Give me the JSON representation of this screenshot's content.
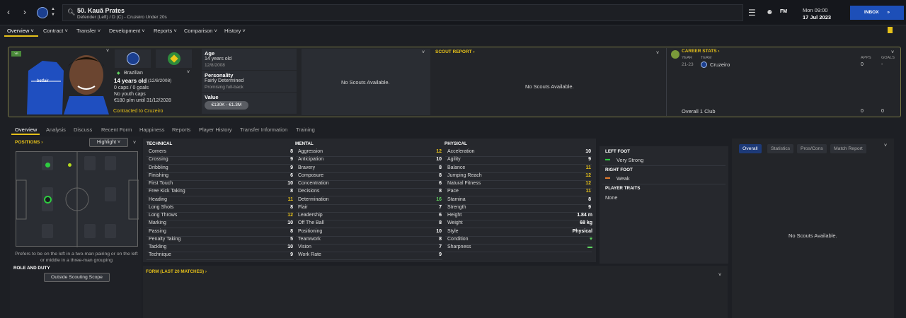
{
  "topbar": {
    "back": "‹",
    "forward": "›",
    "player_title": "50. Kauã Prates",
    "player_subtitle": "Defender (Left) / D (C) - Cruzeiro Under 20s",
    "fm_label": "FM",
    "date_line1": "Mon 09:00",
    "date_line2": "17 Jul 2023",
    "inbox_label": "INBOX"
  },
  "menu": [
    "Overview",
    "Contract",
    "Transfer",
    "Development",
    "Reports",
    "Comparison",
    "History"
  ],
  "profile": {
    "youth_badge": "YR",
    "nationality": "Brazilian",
    "age_line": "14 years old",
    "dob_paren": "(12/8/2008)",
    "caps": "0 caps / 0 goals",
    "youth_caps": "No youth caps",
    "wage": "€180 p/m until 31/12/2028",
    "contract": "Contracted to Cruzeiro",
    "age_title": "Age",
    "age_value": "14 years old",
    "age_dob": "12/8/2008",
    "personality_title": "Personality",
    "personality_value": "Fairly Determined",
    "personality_sub": "Promising full-back",
    "value_title": "Value",
    "value_range": "€130K - €1.3M",
    "no_scouts_1": "No Scouts Available.",
    "scout_report_title": "SCOUT REPORT",
    "no_scouts_2": "No Scouts Available."
  },
  "career": {
    "title": "CAREER STATS",
    "col_year": "YEAR",
    "col_team": "TEAM",
    "col_apps": "APPS",
    "col_goals": "GOALS",
    "row_year": "21-23",
    "row_team": "Cruzeiro",
    "row_apps": "0",
    "row_goals": "-",
    "total_label": "Overall 1 Club",
    "total_apps": "0",
    "total_goals": "0"
  },
  "subtabs": [
    "Overview",
    "Analysis",
    "Discuss",
    "Recent Form",
    "Happiness",
    "Reports",
    "Player History",
    "Transfer Information",
    "Training"
  ],
  "positions": {
    "title": "POSITIONS",
    "highlight": "Highlight",
    "note": "Prefers to be on the left in a two-man pairing or on the left or middle in a three-man grouping",
    "role_title": "ROLE AND DUTY",
    "scope_button": "Outside Scouting Scope"
  },
  "attributes": {
    "technical_title": "TECHNICAL",
    "mental_title": "MENTAL",
    "physical_title": "PHYSICAL",
    "technical": [
      {
        "name": "Corners",
        "value": "8"
      },
      {
        "name": "Crossing",
        "value": "9"
      },
      {
        "name": "Dribbling",
        "value": "9"
      },
      {
        "name": "Finishing",
        "value": "6"
      },
      {
        "name": "First Touch",
        "value": "10"
      },
      {
        "name": "Free Kick Taking",
        "value": "8"
      },
      {
        "name": "Heading",
        "value": "11"
      },
      {
        "name": "Long Shots",
        "value": "8"
      },
      {
        "name": "Long Throws",
        "value": "12"
      },
      {
        "name": "Marking",
        "value": "10"
      },
      {
        "name": "Passing",
        "value": "8"
      },
      {
        "name": "Penalty Taking",
        "value": "5"
      },
      {
        "name": "Tackling",
        "value": "10"
      },
      {
        "name": "Technique",
        "value": "9"
      }
    ],
    "mental": [
      {
        "name": "Aggression",
        "value": "12"
      },
      {
        "name": "Anticipation",
        "value": "10"
      },
      {
        "name": "Bravery",
        "value": "8"
      },
      {
        "name": "Composure",
        "value": "8"
      },
      {
        "name": "Concentration",
        "value": "6"
      },
      {
        "name": "Decisions",
        "value": "8"
      },
      {
        "name": "Determination",
        "value": "16"
      },
      {
        "name": "Flair",
        "value": "7"
      },
      {
        "name": "Leadership",
        "value": "6"
      },
      {
        "name": "Off The Ball",
        "value": "8"
      },
      {
        "name": "Positioning",
        "value": "10"
      },
      {
        "name": "Teamwork",
        "value": "8"
      },
      {
        "name": "Vision",
        "value": "7"
      },
      {
        "name": "Work Rate",
        "value": "9"
      }
    ],
    "physical": [
      {
        "name": "Acceleration",
        "value": "10"
      },
      {
        "name": "Agility",
        "value": "9"
      },
      {
        "name": "Balance",
        "value": "11"
      },
      {
        "name": "Jumping Reach",
        "value": "12"
      },
      {
        "name": "Natural Fitness",
        "value": "12"
      },
      {
        "name": "Pace",
        "value": "11"
      },
      {
        "name": "Stamina",
        "value": "8"
      },
      {
        "name": "Strength",
        "value": "9"
      },
      {
        "name": "Height",
        "value": "1.84 m"
      },
      {
        "name": "Weight",
        "value": "68 kg"
      },
      {
        "name": "Style",
        "value": "Physical"
      },
      {
        "name": "Condition",
        "value": ""
      },
      {
        "name": "Sharpness",
        "value": ""
      }
    ]
  },
  "colors": {
    "high": "#e6c11a",
    "green": "#5fd35f",
    "normal": "#ffffff",
    "accent": "#e6c11a",
    "inbox": "#1d4fb8"
  },
  "form": {
    "title": "FORM (LAST 20 MATCHES)"
  },
  "feet": {
    "left_title": "LEFT FOOT",
    "left_value": "Very Strong",
    "right_title": "RIGHT FOOT",
    "right_value": "Weak",
    "traits_title": "PLAYER TRAITS",
    "traits_value": "None"
  },
  "sidepanel": {
    "tabs": [
      "Overall",
      "Statistics",
      "Pros/Cons",
      "Match Report"
    ],
    "no_scouts": "No Scouts Available."
  }
}
